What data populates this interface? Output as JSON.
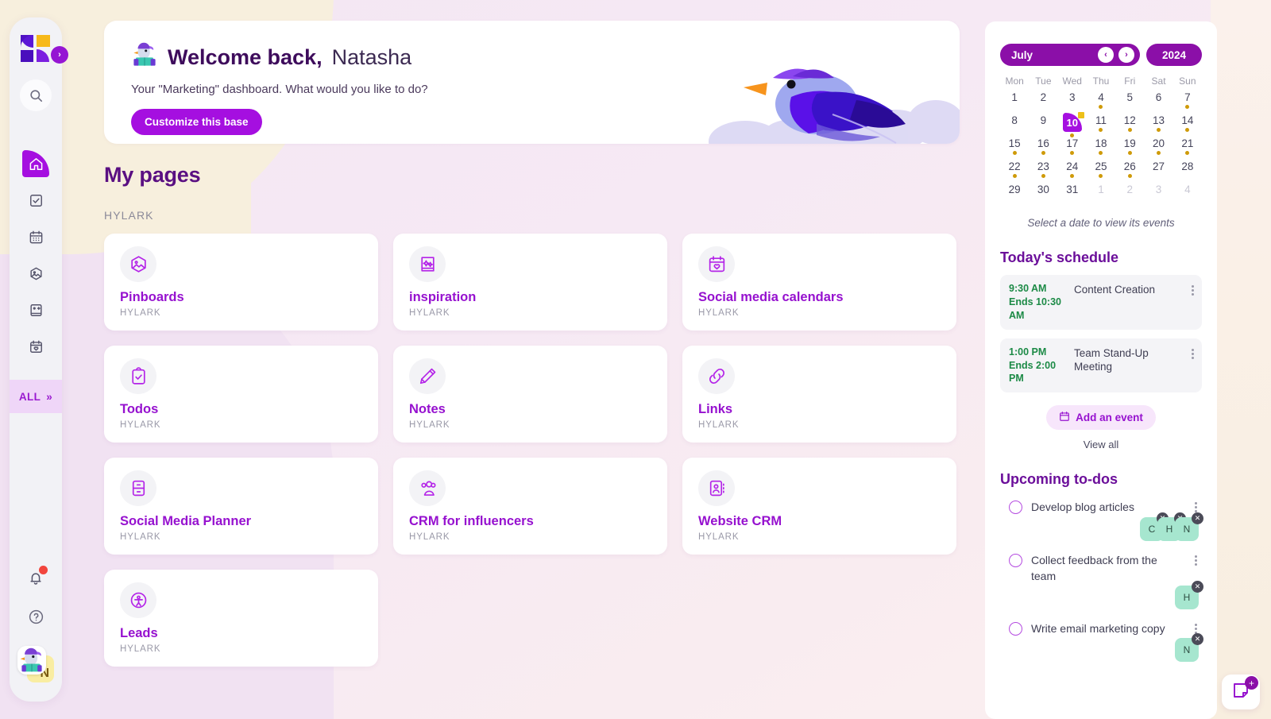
{
  "sidebar": {
    "logo_name": "hylark-logo",
    "expand_label": "›",
    "items": [
      {
        "name": "home",
        "icon": "home-icon",
        "active": true
      },
      {
        "name": "todos",
        "icon": "checkbox-icon",
        "active": false
      },
      {
        "name": "calendar",
        "icon": "calendar-grid-icon",
        "active": false
      },
      {
        "name": "pinboards",
        "icon": "image-hex-icon",
        "active": false
      },
      {
        "name": "notes",
        "icon": "note-add-icon",
        "active": false
      },
      {
        "name": "events",
        "icon": "calendar-heart-icon",
        "active": false
      }
    ],
    "all_label": "ALL",
    "all_chevron": "»",
    "search_icon": "search-icon",
    "bell_icon": "bell-icon",
    "help_icon": "help-circle-icon",
    "avatar_initial": "N"
  },
  "hero": {
    "greeting_bold": "Welcome back,",
    "greeting_name": "Natasha",
    "subtitle": "Your \"Marketing\" dashboard. What would you like to do?",
    "button_label": "Customize this base"
  },
  "main": {
    "page_title": "My pages",
    "group_label": "HYLARK",
    "cards": [
      {
        "title": "Pinboards",
        "subtitle": "HYLARK",
        "icon": "image-hex-icon"
      },
      {
        "title": "inspiration",
        "subtitle": "HYLARK",
        "icon": "sparkle-book-icon"
      },
      {
        "title": "Social media calendars",
        "subtitle": "HYLARK",
        "icon": "calendar-heart-icon"
      },
      {
        "title": "Todos",
        "subtitle": "HYLARK",
        "icon": "clipboard-check-icon"
      },
      {
        "title": "Notes",
        "subtitle": "HYLARK",
        "icon": "pencil-icon"
      },
      {
        "title": "Links",
        "subtitle": "HYLARK",
        "icon": "link-chain-icon"
      },
      {
        "title": "Social Media Planner",
        "subtitle": "HYLARK",
        "icon": "drawer-cabinet-icon"
      },
      {
        "title": "CRM for influencers",
        "subtitle": "HYLARK",
        "icon": "people-group-icon"
      },
      {
        "title": "Website CRM",
        "subtitle": "HYLARK",
        "icon": "contact-book-icon"
      },
      {
        "title": "Leads",
        "subtitle": "HYLARK",
        "icon": "person-target-icon"
      }
    ]
  },
  "calendar": {
    "month": "July",
    "year": "2024",
    "prev_label": "‹",
    "next_label": "›",
    "dow": [
      "Mon",
      "Tue",
      "Wed",
      "Thu",
      "Fri",
      "Sat",
      "Sun"
    ],
    "hint": "Select a date to view its events",
    "today": 10,
    "weeks": [
      [
        {
          "d": "1"
        },
        {
          "d": "2"
        },
        {
          "d": "3"
        },
        {
          "d": "4",
          "dot": true
        },
        {
          "d": "5"
        },
        {
          "d": "6"
        },
        {
          "d": "7",
          "dot": true
        }
      ],
      [
        {
          "d": "8"
        },
        {
          "d": "9"
        },
        {
          "d": "10",
          "today": true,
          "dot": true
        },
        {
          "d": "11",
          "dot": true
        },
        {
          "d": "12",
          "dot": true
        },
        {
          "d": "13",
          "dot": true
        },
        {
          "d": "14",
          "dot": true
        }
      ],
      [
        {
          "d": "15",
          "dot": true
        },
        {
          "d": "16",
          "dot": true
        },
        {
          "d": "17",
          "dot": true
        },
        {
          "d": "18",
          "dot": true
        },
        {
          "d": "19",
          "dot": true
        },
        {
          "d": "20",
          "dot": true
        },
        {
          "d": "21",
          "dot": true
        }
      ],
      [
        {
          "d": "22",
          "dot": true
        },
        {
          "d": "23",
          "dot": true
        },
        {
          "d": "24",
          "dot": true
        },
        {
          "d": "25",
          "dot": true
        },
        {
          "d": "26",
          "dot": true
        },
        {
          "d": "27"
        },
        {
          "d": "28"
        }
      ],
      [
        {
          "d": "29"
        },
        {
          "d": "30"
        },
        {
          "d": "31"
        },
        {
          "d": "1",
          "out": true
        },
        {
          "d": "2",
          "out": true
        },
        {
          "d": "3",
          "out": true
        },
        {
          "d": "4",
          "out": true
        }
      ]
    ]
  },
  "schedule": {
    "heading": "Today's schedule",
    "events": [
      {
        "start": "9:30 AM",
        "end": "Ends 10:30 AM",
        "title": "Content Creation"
      },
      {
        "start": "1:00 PM",
        "end": "Ends 2:00 PM",
        "title": "Team Stand-Up Meeting"
      }
    ],
    "add_label": "Add an event",
    "add_icon": "calendar-icon",
    "view_all_label": "View all"
  },
  "todos": {
    "heading": "Upcoming to-dos",
    "items": [
      {
        "text": "Develop blog articles",
        "chips": [
          "C",
          "H",
          "N"
        ]
      },
      {
        "text": "Collect feedback from the team",
        "chips": [
          "H"
        ]
      },
      {
        "text": "Write email marketing copy",
        "chips": [
          "N"
        ]
      }
    ],
    "chip_close": "✕"
  },
  "fab": {
    "icon": "note-icon",
    "plus": "+"
  },
  "colors": {
    "brand_purple": "#a50fe0",
    "deep_purple": "#8b0fa8",
    "title_purple": "#5a0f82",
    "event_green": "#1c8a46",
    "calendar_dot": "#cf9a09",
    "chip_mint": "#a6e6cf",
    "bg_cream": "#f7efdd",
    "bg_lilac": "#f4e7f3"
  }
}
